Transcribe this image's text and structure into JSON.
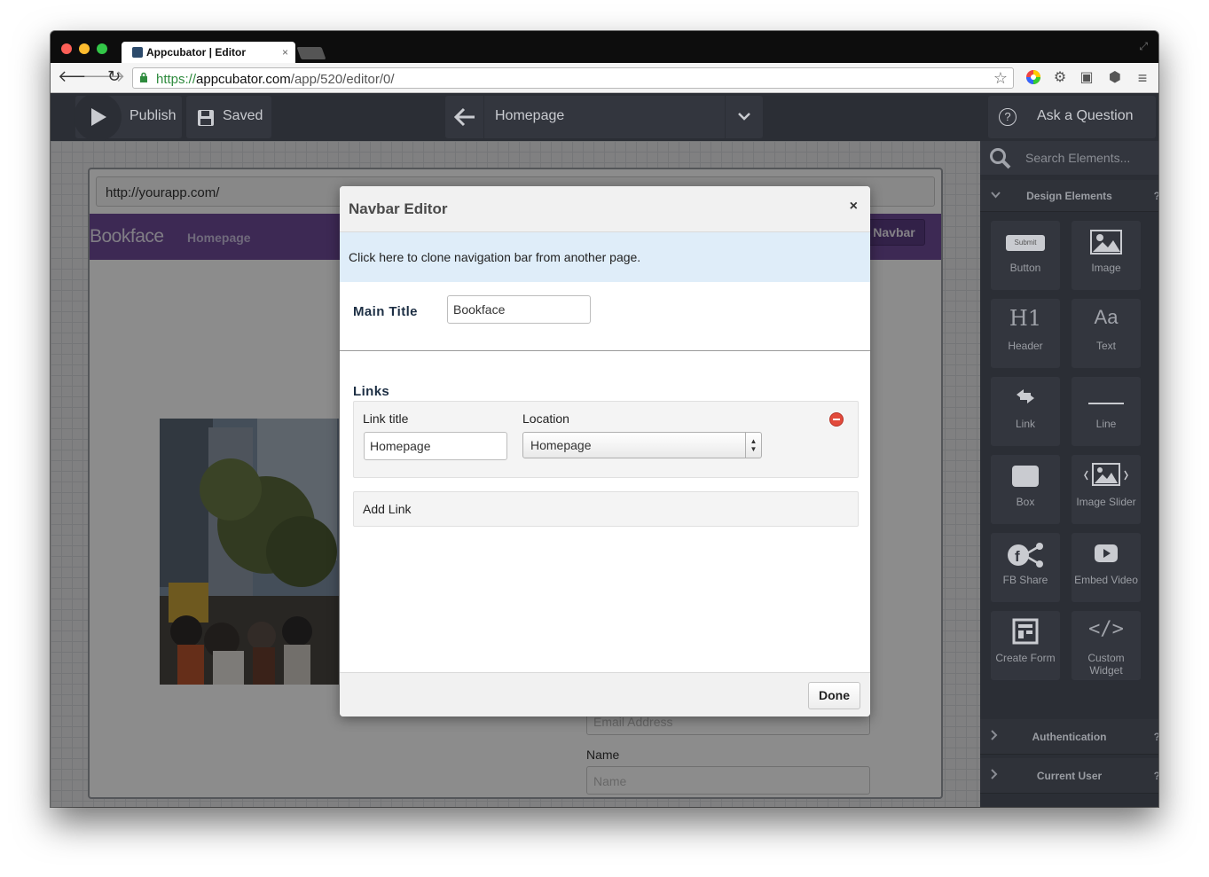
{
  "browser": {
    "tab_title": "Appcubator | Editor",
    "tab_close": "×",
    "url_scheme": "https://",
    "url_host": "appcubator.com",
    "url_path": "/app/520/editor/0/"
  },
  "toolbar": {
    "publish_label": "Publish",
    "saved_label": "Saved",
    "page_name": "Homepage",
    "ask_label": "Ask a Question"
  },
  "canvas": {
    "page_url": "http://yourapp.com/",
    "brand": "Bookface",
    "nav_link": "Homepage",
    "navbar_button": "Navbar",
    "email_placeholder": "Email Address",
    "name_label": "Name",
    "name_placeholder": "Name"
  },
  "sidebar": {
    "search_placeholder": "Search Elements...",
    "design_section": "Design Elements",
    "section_help": "?",
    "elements": [
      {
        "label": "Button",
        "icon": "button-icon",
        "icon_text": "Submit"
      },
      {
        "label": "Image",
        "icon": "image-icon"
      },
      {
        "label": "Header",
        "icon": "header-icon",
        "icon_text": "H1"
      },
      {
        "label": "Text",
        "icon": "text-icon",
        "icon_text": "Aa"
      },
      {
        "label": "Link",
        "icon": "link-icon"
      },
      {
        "label": "Line",
        "icon": "line-icon"
      },
      {
        "label": "Box",
        "icon": "box-icon"
      },
      {
        "label": "Image Slider",
        "icon": "image-slider-icon"
      },
      {
        "label": "FB Share",
        "icon": "fb-share-icon"
      },
      {
        "label": "Embed Video",
        "icon": "video-icon"
      },
      {
        "label": "Create Form",
        "icon": "form-icon"
      },
      {
        "label": "Custom Widget",
        "icon": "code-icon",
        "icon_text": "</>"
      }
    ],
    "auth_section": "Authentication",
    "current_user_section": "Current User"
  },
  "modal": {
    "title": "Navbar Editor",
    "close": "×",
    "clone_text": "Click here to clone navigation bar from another page.",
    "main_title_label": "Main Title",
    "main_title_value": "Bookface",
    "links_label": "Links",
    "link_title_label": "Link title",
    "location_label": "Location",
    "link_title_value": "Homepage",
    "location_value": "Homepage",
    "add_link": "Add Link",
    "done": "Done"
  },
  "colors": {
    "navbar_purple": "#6f4c9a",
    "clone_bar_blue": "#dfedf9",
    "dark_chrome": "#2b2e35",
    "remove_red": "#e24a3b"
  }
}
